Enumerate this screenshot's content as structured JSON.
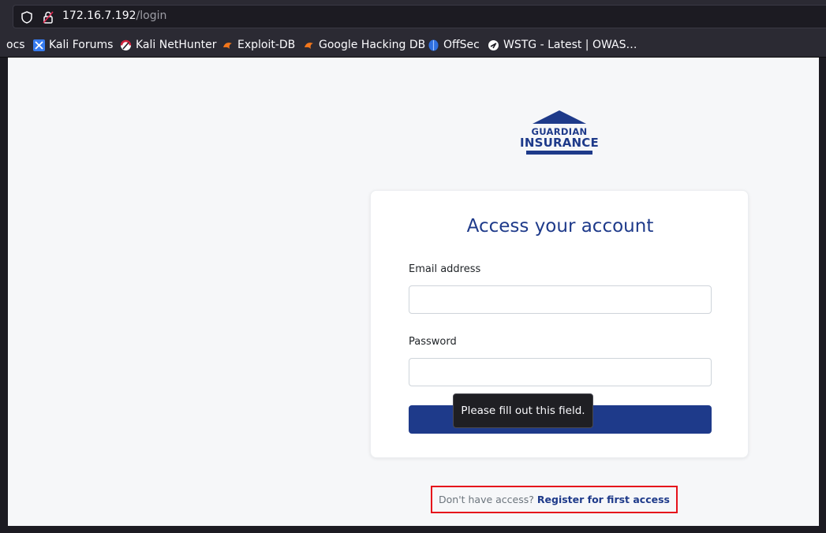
{
  "browser": {
    "url_host": "172.16.7.192",
    "url_path": "/login",
    "bookmarks": [
      {
        "label": "ocs",
        "icon": "none"
      },
      {
        "label": "Kali Forums",
        "icon": "kali-forums-icon"
      },
      {
        "label": "Kali NetHunter",
        "icon": "kali-nethunter-icon"
      },
      {
        "label": "Exploit-DB",
        "icon": "exploit-db-icon"
      },
      {
        "label": "Google Hacking DB",
        "icon": "exploit-db-icon"
      },
      {
        "label": "OffSec",
        "icon": "offsec-icon"
      },
      {
        "label": "WSTG - Latest | OWAS…",
        "icon": "owasp-icon"
      }
    ]
  },
  "logo": {
    "line1": "GUARDIAN",
    "line2": "INSURANCE",
    "color": "#1e3a8a"
  },
  "login": {
    "title": "Access your account",
    "email_label": "Email address",
    "email_value": "",
    "password_label": "Password",
    "password_value": "",
    "access_button": "Access",
    "validation_tooltip": "Please fill out this field."
  },
  "register": {
    "prompt": "Don't have access?",
    "link": "Register for first access",
    "highlight_color": "#e6121b"
  },
  "colors": {
    "brand": "#1e3a8a",
    "page_bg": "#f6f7f9",
    "browser_chrome": "#2b2a33"
  }
}
